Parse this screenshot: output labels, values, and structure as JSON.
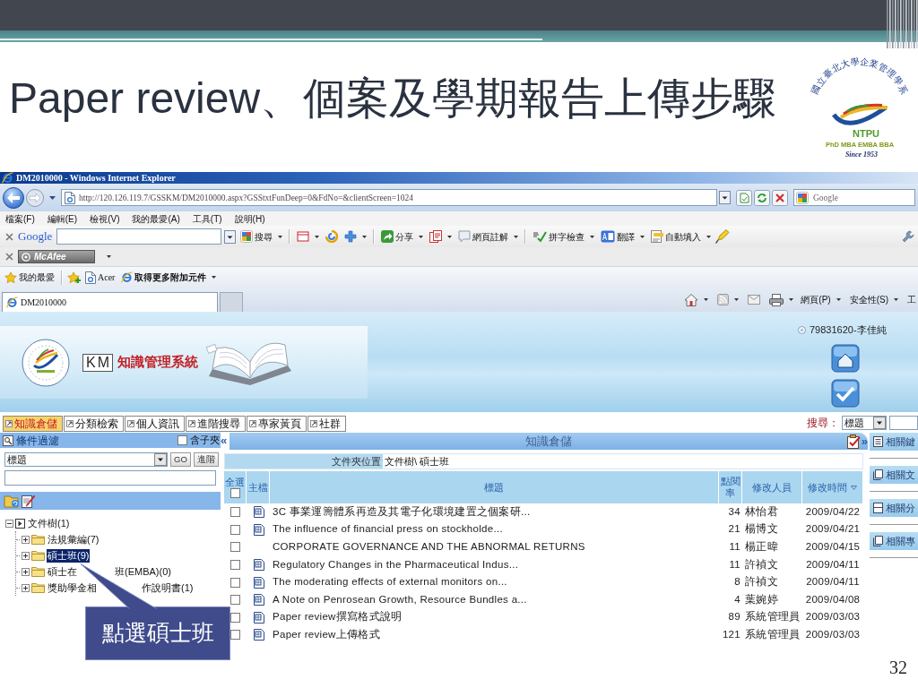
{
  "slide": {
    "title": "Paper review、個案及學期報告上傳步驟",
    "callout": "點選碩士班",
    "page_number": "32"
  },
  "logo": {
    "ring_top": "國立臺北大學企業管理學系",
    "acronym": "NTPU",
    "programs": "PhD MBA EMBA BBA",
    "since": "Since 1953"
  },
  "browser": {
    "window_title": "DM2010000 - Windows Internet Explorer",
    "address": "http://120.126.119.7/GSSKM/DM2010000.aspx?GSStxtFunDeep=0&FdNo=&clientScreen=1024",
    "search_placeholder": "Google",
    "menu": [
      "檔案(F)",
      "編輯(E)",
      "檢視(V)",
      "我的最愛(A)",
      "工具(T)",
      "說明(H)"
    ],
    "google_toolbar": {
      "brand": "Google",
      "buttons": [
        "搜尋",
        "分享",
        "網頁註解",
        "拼字檢查",
        "翻譯",
        "自動填入"
      ]
    },
    "mcafee": "McAfee",
    "favorites_bar": {
      "favorites": "我的最愛",
      "links": [
        {
          "label": "Acer",
          "kind": "page"
        },
        {
          "label": "取得更多附加元件",
          "kind": "gallery"
        }
      ]
    },
    "tabs": [
      {
        "label": "DM2010000",
        "selected": true
      }
    ],
    "command_bar": [
      {
        "label": "網頁(P)",
        "menu": true
      },
      {
        "label": "安全性(S)",
        "menu": true
      },
      {
        "label": "工",
        "menu": false
      }
    ]
  },
  "km": {
    "brand_mark": "KM",
    "system_title": "知識管理系統",
    "user": "79831620-李佳純",
    "nav_tabs": [
      {
        "label": "知識倉儲",
        "selected": true
      },
      {
        "label": "分類檢索",
        "selected": false
      },
      {
        "label": "個人資訊",
        "selected": false
      },
      {
        "label": "進階搜尋",
        "selected": false
      },
      {
        "label": "專家黃頁",
        "selected": false
      },
      {
        "label": "社群",
        "selected": false
      }
    ],
    "search": {
      "label": "搜尋：",
      "field": "標題"
    },
    "filter": {
      "title": "條件過濾",
      "subfolders": {
        "label": "含子夾",
        "checked": false
      },
      "field": "標題",
      "buttons": [
        "GO",
        "進階"
      ]
    },
    "tree": {
      "label": "文件樹(1)",
      "expanded": true,
      "children": [
        {
          "label": "法規彙編(7)",
          "expanded": false,
          "selected": false
        },
        {
          "label": "碩士班(9)",
          "expanded": false,
          "selected": true
        },
        {
          "label": "碩士在",
          "label_after_callout": "班(EMBA)(0)",
          "expanded": false,
          "selected": false
        },
        {
          "label": "獎助學金相",
          "label_after_callout": "作說明書(1)",
          "expanded": false,
          "selected": false
        }
      ]
    },
    "repository": {
      "collapse": "«",
      "expand": "»",
      "title": "知識倉儲",
      "location_label": "文件夾位置",
      "location": "文件樹\\ 碩士班",
      "select_all": {
        "label": "全選",
        "checked": false
      },
      "columns": [
        {
          "label": "主檔",
          "sorted": false
        },
        {
          "label": "標題",
          "sorted": false
        },
        {
          "label": "點閱率",
          "sorted": false
        },
        {
          "label": "修改人員",
          "sorted": false
        },
        {
          "label": "修改時間",
          "sorted": true
        }
      ],
      "rows": [
        {
          "checked": false,
          "has_file": true,
          "title": "3C 事業運籌體系再造及其電子化環境建置之個案研...",
          "views": "34",
          "editor": "林怡君",
          "modified": "2009/04/22"
        },
        {
          "checked": false,
          "has_file": true,
          "title": "The influence of financial press on stockholde...",
          "views": "21",
          "editor": "楊博文",
          "modified": "2009/04/21"
        },
        {
          "checked": false,
          "has_file": false,
          "title": "CORPORATE GOVERNANCE AND THE ABNORMAL RETURNS",
          "views": "11",
          "editor": "楊正暐",
          "modified": "2009/04/15"
        },
        {
          "checked": false,
          "has_file": true,
          "title": "Regulatory Changes in the Pharmaceutical Indus...",
          "views": "11",
          "editor": "許禎文",
          "modified": "2009/04/11"
        },
        {
          "checked": false,
          "has_file": true,
          "title": "The moderating effects of external monitors on...",
          "views": "8",
          "editor": "許禎文",
          "modified": "2009/04/11"
        },
        {
          "checked": false,
          "has_file": true,
          "title": "A Note on Penrosean Growth, Resource Bundles a...",
          "views": "4",
          "editor": "葉婉婷",
          "modified": "2009/04/08"
        },
        {
          "checked": false,
          "has_file": true,
          "title": "Paper review撰寫格式說明",
          "views": "89",
          "editor": "系統管理員",
          "modified": "2009/03/03"
        },
        {
          "checked": false,
          "has_file": true,
          "title": "Paper review上傳格式",
          "views": "121",
          "editor": "系統管理員",
          "modified": "2009/03/03"
        }
      ]
    },
    "related": [
      "相關鍵",
      "相關文",
      "相關分",
      "相關專"
    ]
  }
}
